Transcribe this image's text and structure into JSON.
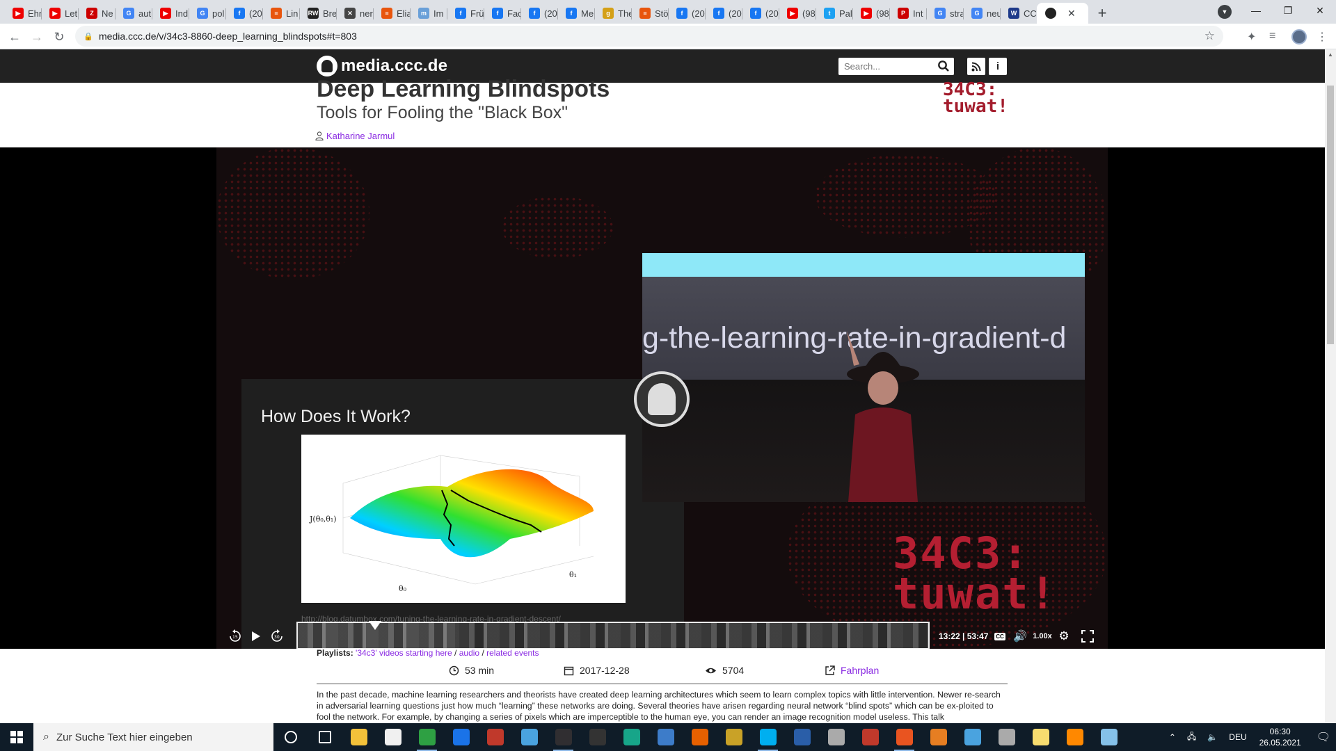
{
  "browser": {
    "tabs": [
      {
        "title": "Ehr",
        "fav": "#e00",
        "glyph": "▶"
      },
      {
        "title": "Let",
        "fav": "#e00",
        "glyph": "▶"
      },
      {
        "title": "Ne",
        "fav": "#c00",
        "glyph": "Z"
      },
      {
        "title": "aut",
        "fav": "#4285f4",
        "glyph": "G"
      },
      {
        "title": "Ind",
        "fav": "#e00",
        "glyph": "▶"
      },
      {
        "title": "pol",
        "fav": "#4285f4",
        "glyph": "G"
      },
      {
        "title": "(20",
        "fav": "#1877f2",
        "glyph": "f"
      },
      {
        "title": "Lin",
        "fav": "#e8550d",
        "glyph": "≡"
      },
      {
        "title": "Bre",
        "fav": "#222",
        "glyph": "RW"
      },
      {
        "title": "ner",
        "fav": "#444",
        "glyph": "✕"
      },
      {
        "title": "Elia",
        "fav": "#e8550d",
        "glyph": "≡"
      },
      {
        "title": "Im",
        "fav": "#6aa0d8",
        "glyph": "m"
      },
      {
        "title": "Frü",
        "fav": "#1877f2",
        "glyph": "f"
      },
      {
        "title": "Fac",
        "fav": "#1877f2",
        "glyph": "f"
      },
      {
        "title": "(20",
        "fav": "#1877f2",
        "glyph": "f"
      },
      {
        "title": "Me",
        "fav": "#1877f2",
        "glyph": "f"
      },
      {
        "title": "The",
        "fav": "#d4a017",
        "glyph": "g"
      },
      {
        "title": "Stö",
        "fav": "#e8550d",
        "glyph": "≡"
      },
      {
        "title": "(20",
        "fav": "#1877f2",
        "glyph": "f"
      },
      {
        "title": "(20",
        "fav": "#1877f2",
        "glyph": "f"
      },
      {
        "title": "(20",
        "fav": "#1877f2",
        "glyph": "f"
      },
      {
        "title": "(98",
        "fav": "#e00",
        "glyph": "▶"
      },
      {
        "title": "Pal",
        "fav": "#1da1f2",
        "glyph": "t"
      },
      {
        "title": "(98",
        "fav": "#e00",
        "glyph": "▶"
      },
      {
        "title": "Int",
        "fav": "#c00",
        "glyph": "P"
      },
      {
        "title": "stra",
        "fav": "#4285f4",
        "glyph": "G"
      },
      {
        "title": "neu",
        "fav": "#4285f4",
        "glyph": "G"
      },
      {
        "title": "CC",
        "fav": "#1e3a8a",
        "glyph": "W"
      }
    ],
    "active_tab": {
      "title": "",
      "fav": "#222"
    },
    "url": "media.ccc.de/v/34c3-8860-deep_learning_blindspots#t=803"
  },
  "site": {
    "logo": "media.ccc.de",
    "search_placeholder": "Search...",
    "rss_icon": "rss-icon",
    "info_icon": "info-icon"
  },
  "talk": {
    "title": "Deep Learning Blindspots",
    "subtitle": "Tools for Fooling the \"Black Box\"",
    "speaker": "Katharine Jarmul",
    "conf_badge_line1": "34C3:",
    "conf_badge_line2": "tuwat!"
  },
  "video": {
    "slide_title": "How Does It Work?",
    "slide_url": "http://blog.datumbox.com/tuning-the-learning-rate-in-gradient-descent/",
    "camera_screen_text": "g-the-learning-rate-in-gradient-d",
    "overlay_badge_line1": "34C3:",
    "overlay_badge_line2": "tuwat!",
    "time_current": "13:22",
    "time_total": "53:47",
    "played_fraction": 0.249,
    "speed": "1.00x",
    "cc_label": "CC"
  },
  "details": {
    "playlists_label": "Playlists:",
    "playlist_1": "'34c3' videos starting here",
    "playlist_2": "audio",
    "playlist_3": "related events",
    "duration": "53 min",
    "date": "2017-12-28",
    "views": "5704",
    "fahrplan": "Fahrplan",
    "description": "In the past decade, machine learning researchers and theorists have created deep learning architectures which seem to learn complex topics with little intervention. Newer re-search in adversarial learning questions just how much “learning” these networks are doing. Several theories have arisen regarding neural network “blind spots” which can be ex-ploited to fool the network. For example, by changing a series of pixels which are imperceptible to the human eye, you can render an image recognition model useless. This talk"
  },
  "taskbar": {
    "search_placeholder": "Zur Suche Text hier eingeben",
    "lang": "DEU",
    "time": "06:30",
    "date": "26.05.2021",
    "apps": [
      {
        "name": "cortana-icon",
        "color": "#0f1c28",
        "open": false
      },
      {
        "name": "task-view-icon",
        "color": "#0f1c28",
        "open": false
      },
      {
        "name": "file-explorer-icon",
        "color": "#f3c13a",
        "open": false
      },
      {
        "name": "store-icon",
        "color": "#f0f0f0",
        "open": false
      },
      {
        "name": "chrome-icon",
        "color": "#2ea043",
        "open": true
      },
      {
        "name": "edge-icon",
        "color": "#1a73e8",
        "open": false
      },
      {
        "name": "voicemeeter-icon",
        "color": "#c0392b",
        "open": false
      },
      {
        "name": "app-icon",
        "color": "#4aa3df",
        "open": false
      },
      {
        "name": "obs-icon",
        "color": "#302e31",
        "open": true
      },
      {
        "name": "live-icon",
        "color": "#333",
        "open": false
      },
      {
        "name": "camtasia-icon",
        "color": "#17a589",
        "open": false
      },
      {
        "name": "powerautomate-icon",
        "color": "#3d7cc9",
        "open": false
      },
      {
        "name": "firefox-icon",
        "color": "#e66000",
        "open": false
      },
      {
        "name": "pen-icon",
        "color": "#c9a227",
        "open": false
      },
      {
        "name": "skype-icon",
        "color": "#00aff0",
        "open": true
      },
      {
        "name": "virtualbox-icon",
        "color": "#2a5ea8",
        "open": false
      },
      {
        "name": "app2-icon",
        "color": "#aaa",
        "open": false
      },
      {
        "name": "scrivener-icon",
        "color": "#c0392b",
        "open": false
      },
      {
        "name": "ubuntu-icon",
        "color": "#e95420",
        "open": true
      },
      {
        "name": "xming-icon",
        "color": "#e67e22",
        "open": false
      },
      {
        "name": "app3-icon",
        "color": "#4aa3df",
        "open": false
      },
      {
        "name": "app4-icon",
        "color": "#aaa",
        "open": false
      },
      {
        "name": "notes-icon",
        "color": "#f7dc6f",
        "open": false
      },
      {
        "name": "vlc-icon",
        "color": "#ff8800",
        "open": false
      },
      {
        "name": "app5-icon",
        "color": "#85c1e9",
        "open": false
      }
    ]
  }
}
